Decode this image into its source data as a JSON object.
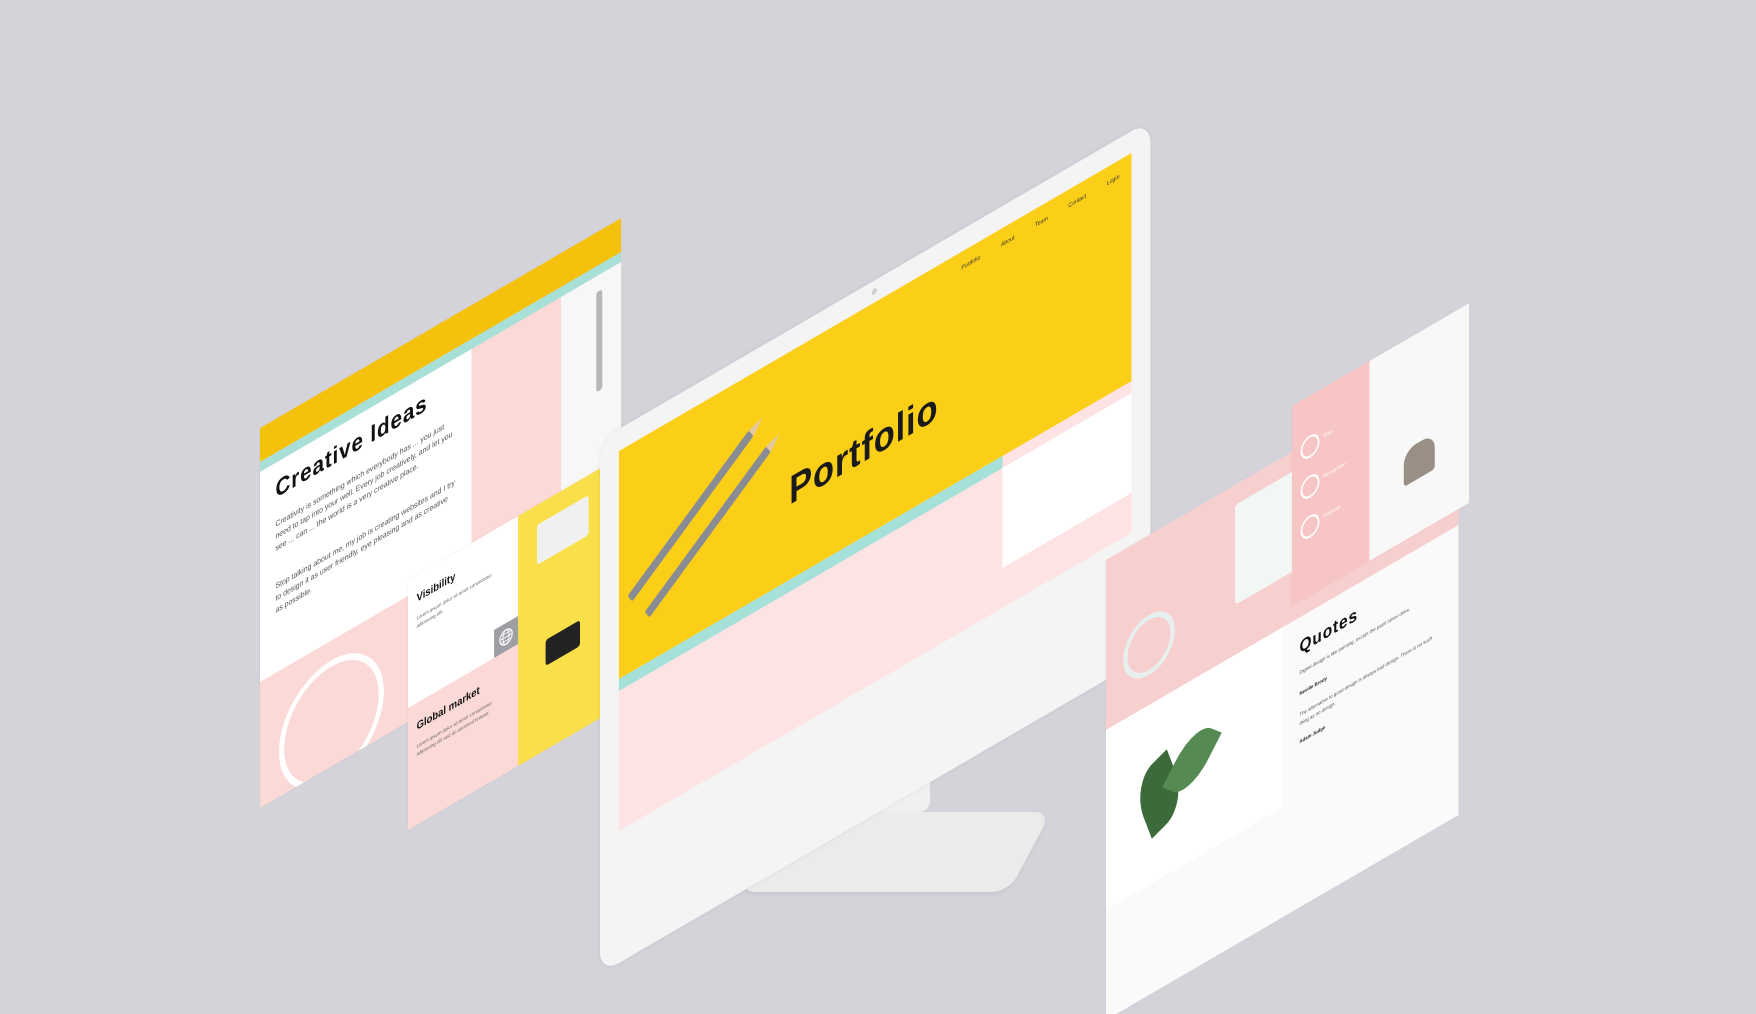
{
  "colors": {
    "background": "#d4d3da",
    "yellow": "#fbcf17",
    "mint": "#a6e1d9",
    "pink": "#fbd9d7"
  },
  "creative": {
    "title": "Creative Ideas",
    "para1": "Creativity is something which everybody has ... you just need to tap into your well. Every job creatively, and let you see ... can ... the world is a very creative place.",
    "para2": "Stop talking about me, my job is creating websites and I try to design it as user friendly, eye pleasing and as creative as possible."
  },
  "visibility": {
    "title": "Visibility",
    "text": "Lorem ipsum dolor sit amet consectetur adipiscing elit.",
    "market_title": "Global market",
    "market_text": "Lorem ipsum dolor sit amet consectetur adipiscing elit sed do eiusmod tempor."
  },
  "monitor": {
    "title": "Portfolio",
    "nav": [
      "Portfolio",
      "About",
      "Team",
      "Contact",
      "Login"
    ]
  },
  "quotes": {
    "title": "Quotes",
    "q1": "Digital design is like painting, except the paint never dries.",
    "a1": "Neville Brody",
    "q2": "The alternative to good design is always bad design. There is no such thing as no design.",
    "a2": "Adam Judge"
  },
  "icons": {
    "items": [
      "Time",
      "Recognition",
      "Financial"
    ]
  }
}
